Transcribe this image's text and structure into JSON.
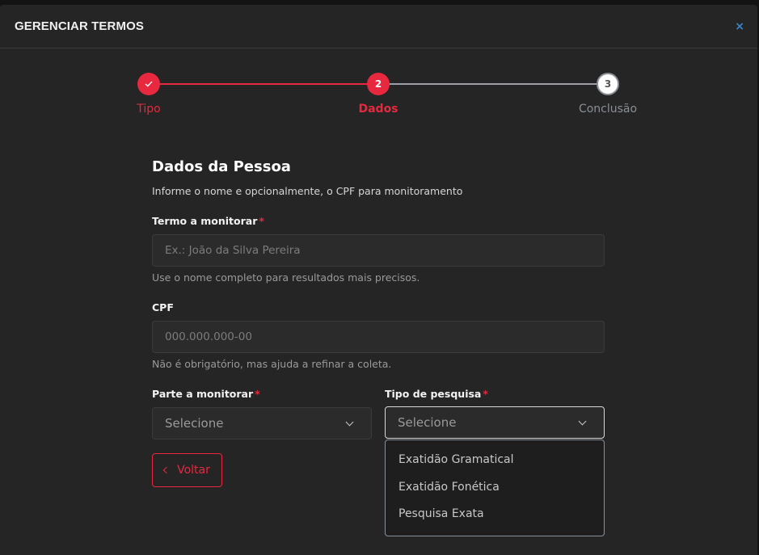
{
  "header": {
    "title": "GERENCIAR TERMOS",
    "close_label": "×"
  },
  "stepper": {
    "steps": [
      {
        "number": "✓",
        "label": "Tipo",
        "state": "complete"
      },
      {
        "number": "2",
        "label": "Dados",
        "state": "active"
      },
      {
        "number": "3",
        "label": "Conclusão",
        "state": "pending"
      }
    ]
  },
  "form": {
    "title": "Dados da Pessoa",
    "subtitle": "Informe o nome e opcionalmente, o CPF para monitoramento",
    "termo": {
      "label": "Termo a monitorar",
      "required": "*",
      "value": "",
      "placeholder": "Ex.: João da Silva Pereira",
      "hint": "Use o nome completo para resultados mais precisos."
    },
    "cpf": {
      "label": "CPF",
      "value": "",
      "placeholder": "000.000.000-00",
      "hint": "Não é obrigatório, mas ajuda a refinar a coleta."
    },
    "parte": {
      "label": "Parte a monitorar",
      "required": "*",
      "value": "Selecione"
    },
    "tipo": {
      "label": "Tipo de pesquisa",
      "required": "*",
      "value": "Selecione",
      "options": [
        "Exatidão Gramatical",
        "Exatidão Fonética",
        "Pesquisa Exata"
      ]
    },
    "back_label": "Voltar"
  },
  "colors": {
    "accent": "#e8283e",
    "background": "#252525",
    "close": "#3b86c8"
  }
}
